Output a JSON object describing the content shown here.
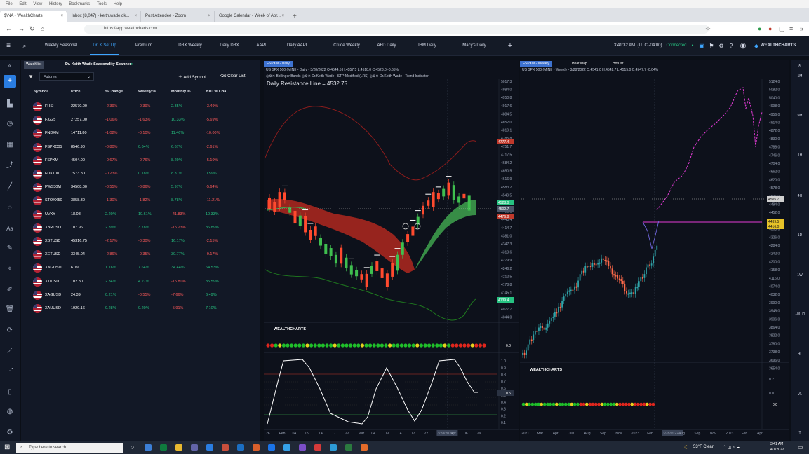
{
  "browser": {
    "menu": [
      "File",
      "Edit",
      "View",
      "History",
      "Bookmarks",
      "Tools",
      "Help"
    ],
    "tabs": [
      {
        "label": "$\\NA - WealthCharts",
        "active": true
      },
      {
        "label": "Inbox (8,047) - keith.wade.dk...",
        "active": false
      },
      {
        "label": "Post Attendee - Zoom",
        "active": false
      },
      {
        "label": "Google Calendar - Week of Apr...",
        "active": false
      }
    ],
    "new_tab": "+",
    "url": "https://app.wealthcharts.com"
  },
  "app": {
    "nav_tabs": [
      "Weekly Seasonal",
      "Dr. K Set Up",
      "Premium",
      "DBX Weekly",
      "Daily DBX",
      "AAPL",
      "Daily AAPL",
      "Crude Weekly",
      "AFD Daily",
      "IBM Daily",
      "Macy's Daily"
    ],
    "active_tab": "Dr. K Set Up",
    "add_tab": "+",
    "time": "3:41:32 AM",
    "timezone": "(UTC -04:00)",
    "status": "Connected",
    "brand": "WEALTHCHARTS",
    "colors": {
      "accent": "#3ea6ff",
      "connected": "#26c281",
      "up": "#26c281",
      "down": "#ff5a5a"
    }
  },
  "watchlist": {
    "tab_watchlist": "Watchlist",
    "tab_scanner": "Dr. Keith Wade Seasonality Scanner",
    "filter": "Futures",
    "add_symbol": "Add Symbol",
    "clear_list": "Clear List",
    "columns": [
      "Symbol",
      "Price",
      "%Change",
      "Weekly % ...",
      "Monthly % ...",
      "YTD % Cha..."
    ],
    "rows": [
      {
        "symbol": "FHSI",
        "price": "22570.00",
        "chg": "-2.39%",
        "weekly": "-0.39%",
        "monthly": "2.35%",
        "ytd": "-3.49%"
      },
      {
        "symbol": "FJ225",
        "price": "27257.00",
        "chg": "-1.06%",
        "weekly": "-1.63%",
        "monthly": "10.33%",
        "ytd": "-5.69%"
      },
      {
        "symbol": "FNDXM",
        "price": "14711.80",
        "chg": "-1.02%",
        "weekly": "-0.10%",
        "monthly": "11.46%",
        "ytd": "-10.00%"
      },
      {
        "symbol": "FSPXC05",
        "price": "8546.90",
        "chg": "-0.80%",
        "weekly": "0.64%",
        "monthly": "6.67%",
        "ytd": "-2.61%"
      },
      {
        "symbol": "FSPXM",
        "price": "4504.00",
        "chg": "-0.67%",
        "weekly": "-0.76%",
        "monthly": "8.29%",
        "ytd": "-5.10%"
      },
      {
        "symbol": "FUK100",
        "price": "7573.80",
        "chg": "-0.23%",
        "weekly": "0.18%",
        "monthly": "8.31%",
        "ytd": "0.59%"
      },
      {
        "symbol": "FWS30M",
        "price": "34508.00",
        "chg": "-0.55%",
        "weekly": "-0.86%",
        "monthly": "5.97%",
        "ytd": "-5.64%"
      },
      {
        "symbol": "STOXX50",
        "price": "3858.30",
        "chg": "-1.30%",
        "weekly": "-1.82%",
        "monthly": "8.78%",
        "ytd": "-11.21%"
      },
      {
        "symbol": "UVXY",
        "price": "18.08",
        "chg": "2.20%",
        "weekly": "10.61%",
        "monthly": "-41.83%",
        "ytd": "10.33%"
      },
      {
        "symbol": "XBRUSD",
        "price": "107.96",
        "chg": "2.39%",
        "weekly": "3.78%",
        "monthly": "-15.23%",
        "ytd": "36.89%"
      },
      {
        "symbol": "XBTUSD",
        "price": "45316.75",
        "chg": "-2.17%",
        "weekly": "-0.30%",
        "monthly": "16.17%",
        "ytd": "-2.15%"
      },
      {
        "symbol": "XETUSD",
        "price": "3345.04",
        "chg": "-2.86%",
        "weekly": "-0.35%",
        "monthly": "30.77%",
        "ytd": "-9.17%"
      },
      {
        "symbol": "XNGUSD",
        "price": "6.19",
        "chg": "1.16%",
        "weekly": "7.64%",
        "monthly": "34.44%",
        "ytd": "64.53%"
      },
      {
        "symbol": "XTIUSD",
        "price": "102.80",
        "chg": "2.34%",
        "weekly": "4.27%",
        "monthly": "-15.80%",
        "ytd": "35.59%"
      },
      {
        "symbol": "XAGUSD",
        "price": "24.39",
        "chg": "0.21%",
        "weekly": "-0.55%",
        "monthly": "-7.66%",
        "ytd": "6.49%"
      },
      {
        "symbol": "XAUUSD",
        "price": "1929.16",
        "chg": "0.28%",
        "weekly": "0.20%",
        "monthly": "-5.91%",
        "ytd": "7.10%"
      }
    ]
  },
  "daily_chart": {
    "tab": "FSPXM - Daily",
    "legend": "US SPX 500 (MINI) - Daily - 3/28/2022 O:4544.5 H:4557.5 L:4518.0 C:4528.0 -0.65%",
    "indicators": [
      "Bollinger Bands",
      "Dr.Keith Wade - STP Modified (LRS)",
      "Dr.Keith Wade - Trend Indicator"
    ],
    "annotation": "Daily Resistance Line = 4532.75",
    "price_ticks": [
      "5017.3",
      "4984.0",
      "4950.8",
      "4917.6",
      "4884.5",
      "4852.0",
      "4819.1",
      "4785.8",
      "4751.7",
      "4717.5",
      "4684.2",
      "4650.5",
      "4616.9",
      "4583.2",
      "4549.5",
      "4515.8",
      "4482.1",
      "4448.4",
      "4414.7",
      "4381.0",
      "4347.3",
      "4313.6",
      "4279.9",
      "4246.2",
      "4212.5",
      "4178.8",
      "4145.1",
      "4111.4",
      "4077.7",
      "4044.0"
    ],
    "price_labels": [
      {
        "text": "4777.4",
        "color": "#c0392b"
      },
      {
        "text": "4528.0",
        "color": "#26c281"
      },
      {
        "text": "4502.7",
        "color": "#4a5568"
      },
      {
        "text": "4476.8",
        "color": "#c0392b"
      },
      {
        "text": "4139.4",
        "color": "#26c281"
      }
    ],
    "date_ticks": [
      "26",
      "Feb",
      "04",
      "09",
      "14",
      "17",
      "22",
      "Mar",
      "04",
      "09",
      "14",
      "17",
      "22",
      "3/28/2022",
      "Apr",
      "06",
      "29"
    ],
    "logo": "WEALTHCHARTS",
    "osc_ticks": [
      "1.0",
      "0.9",
      "0.8",
      "0.7",
      "0.6",
      "0.5",
      "0.4",
      "0.3",
      "0.2",
      "0.1"
    ],
    "dot_strip_value": "0.0",
    "osc_value": "0.5"
  },
  "weekly_chart": {
    "tab": "FSPXM - Weekly",
    "tab_heatmap": "Heat Map",
    "tab_hotlist": "HotList",
    "legend": "US SPX 500 (MINI) - Weekly - 3/28/2022 O:4541.0 H:4542.7 L:4515.0 C:4547.7 -0.04%",
    "price_ticks": [
      "5124.0",
      "5082.0",
      "5040.0",
      "4998.0",
      "4956.0",
      "4914.0",
      "4872.0",
      "4830.0",
      "4788.0",
      "4746.0",
      "4704.0",
      "4662.0",
      "4620.0",
      "4578.0",
      "4536.0",
      "4494.0",
      "4452.0",
      "4410.0",
      "4368.0",
      "4326.0",
      "4284.0",
      "4242.0",
      "4200.0",
      "4158.0",
      "4116.0",
      "4074.0",
      "4032.0",
      "3990.0",
      "3948.0",
      "3906.0",
      "3864.0",
      "3822.0",
      "3780.0",
      "3738.0",
      "3696.0",
      "3654.0"
    ],
    "price_labels": [
      {
        "text": "4505.7",
        "color": "#d0d0d0"
      },
      {
        "text": "4439.5",
        "color": "#e6c229"
      },
      {
        "text": "4416.0",
        "color": "#e6c229"
      }
    ],
    "date_ticks": [
      "2021",
      "Mar",
      "Apr",
      "Jun",
      "Aug",
      "Sep",
      "Nov",
      "2022",
      "Feb",
      "3/28/2022",
      "Aug",
      "Sep",
      "Nov",
      "2023",
      "Feb",
      "Apr"
    ],
    "logo": "WEALTHCHARTS",
    "osc_ticks": [
      "0.0",
      "0.2"
    ],
    "dot_strip_value": "0.0"
  },
  "timeframes": [
    "1M",
    "5M",
    "1H",
    "4H",
    "1D",
    "1W",
    "1MTH",
    "HL",
    "VL",
    "T"
  ],
  "taskbar": {
    "search": "Type here to search",
    "weather": "53°F Clear",
    "clock_time": "3:41 AM",
    "clock_date": "4/1/2022"
  }
}
